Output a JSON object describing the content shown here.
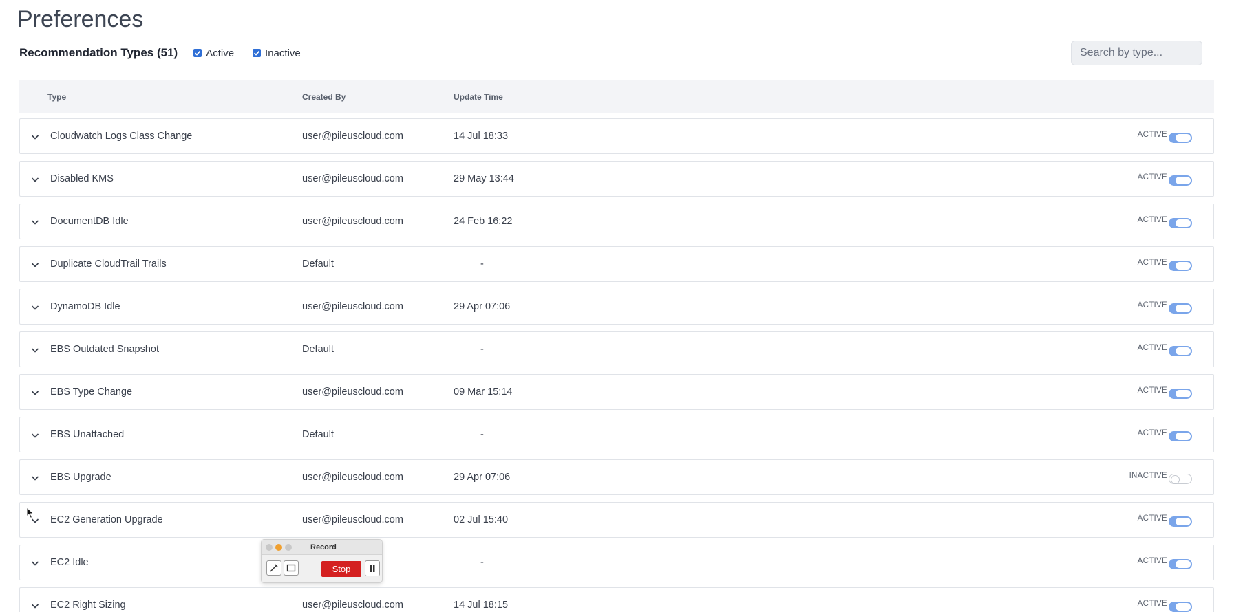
{
  "page": {
    "title": "Preferences"
  },
  "toolbar": {
    "heading": "Recommendation Types (51)",
    "filters": [
      {
        "label": "Active",
        "checked": true
      },
      {
        "label": "Inactive",
        "checked": true
      }
    ],
    "search_placeholder": "Search by type..."
  },
  "table": {
    "columns": {
      "type": "Type",
      "created_by": "Created By",
      "update_time": "Update Time"
    },
    "rows": [
      {
        "type": "Cloudwatch Logs Class Change",
        "created_by": "user@pileuscloud.com",
        "update_time": "14 Jul 18:33",
        "status": "ACTIVE"
      },
      {
        "type": "Disabled KMS",
        "created_by": "user@pileuscloud.com",
        "update_time": "29 May 13:44",
        "status": "ACTIVE"
      },
      {
        "type": "DocumentDB Idle",
        "created_by": "user@pileuscloud.com",
        "update_time": "24 Feb 16:22",
        "status": "ACTIVE"
      },
      {
        "type": "Duplicate CloudTrail Trails",
        "created_by": "Default",
        "update_time": "-",
        "status": "ACTIVE"
      },
      {
        "type": "DynamoDB Idle",
        "created_by": "user@pileuscloud.com",
        "update_time": "29 Apr 07:06",
        "status": "ACTIVE"
      },
      {
        "type": "EBS Outdated Snapshot",
        "created_by": "Default",
        "update_time": "-",
        "status": "ACTIVE"
      },
      {
        "type": "EBS Type Change",
        "created_by": "user@pileuscloud.com",
        "update_time": "09 Mar 15:14",
        "status": "ACTIVE"
      },
      {
        "type": "EBS Unattached",
        "created_by": "Default",
        "update_time": "-",
        "status": "ACTIVE"
      },
      {
        "type": "EBS Upgrade",
        "created_by": "user@pileuscloud.com",
        "update_time": "29 Apr 07:06",
        "status": "INACTIVE"
      },
      {
        "type": "EC2 Generation Upgrade",
        "created_by": "user@pileuscloud.com",
        "update_time": "02 Jul 15:40",
        "status": "ACTIVE"
      },
      {
        "type": "EC2 Idle",
        "created_by": "",
        "update_time": "-",
        "status": "ACTIVE"
      },
      {
        "type": "EC2 Right Sizing",
        "created_by": "user@pileuscloud.com",
        "update_time": "14 Jul 18:15",
        "status": "ACTIVE"
      }
    ]
  },
  "recorder": {
    "title": "Record",
    "stop_label": "Stop",
    "pause_icon": "pause-icon"
  },
  "colors": {
    "accent": "#2f6fd6",
    "toggle_on": "#7aa5ea",
    "stop_red": "#d42020"
  }
}
